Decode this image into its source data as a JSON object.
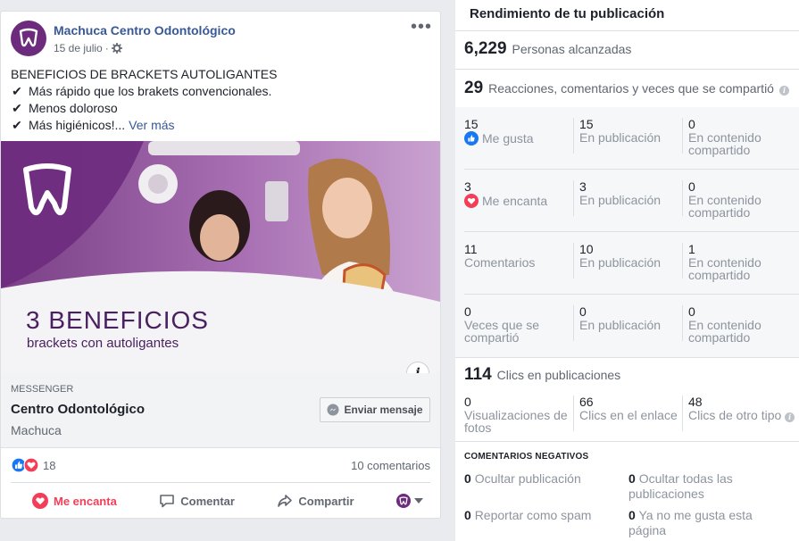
{
  "post": {
    "page_name": "Machuca Centro Odontológico",
    "date": "15 de julio",
    "date_sep": "·",
    "more_icon": "more-dots-icon",
    "text": {
      "heading": "BENEFICIOS DE BRACKETS AUTOLIGANTES",
      "bullets": [
        "Más rápido que los brakets convencionales.",
        "Menos doloroso",
        "Más higiénicos!..."
      ],
      "see_more": "Ver más"
    },
    "image": {
      "title": "3 BENEFICIOS",
      "subtitle": "brackets con autoligantes",
      "info_label": "i"
    },
    "cta": {
      "tag": "MESSENGER",
      "title": "Centro Odontológico",
      "subtitle": "Machuca",
      "button_label": "Enviar mensaje"
    },
    "reactions": {
      "count": "18",
      "comments": "10 comentarios"
    },
    "actions": {
      "love": "Me encanta",
      "comment": "Comentar",
      "share": "Compartir"
    }
  },
  "insights": {
    "title": "Rendimiento de tu publicación",
    "reach": {
      "value": "6,229",
      "label": "Personas alcanzadas"
    },
    "engagement": {
      "value": "29",
      "label": "Reacciones, comentarios y veces que se compartió"
    },
    "rows": [
      {
        "total": "15",
        "label": "Me gusta",
        "icon": "like-icon",
        "post": "15",
        "post_label": "En publicación",
        "shared": "0",
        "shared_label": "En contenido compartido"
      },
      {
        "total": "3",
        "label": "Me encanta",
        "icon": "love-icon",
        "post": "3",
        "post_label": "En publicación",
        "shared": "0",
        "shared_label": "En contenido compartido"
      },
      {
        "total": "11",
        "label": "Comentarios",
        "post": "10",
        "post_label": "En publicación",
        "shared": "1",
        "shared_label": "En contenido compartido"
      },
      {
        "total": "0",
        "label": "Veces que se compartió",
        "post": "0",
        "post_label": "En publicación",
        "shared": "0",
        "shared_label": "En contenido compartido"
      }
    ],
    "clicks": {
      "value": "114",
      "label": "Clics en publicaciones",
      "photos": {
        "value": "0",
        "label": "Visualizaciones de fotos"
      },
      "link": {
        "value": "66",
        "label": "Clics en el enlace"
      },
      "other": {
        "value": "48",
        "label": "Clics de otro tipo"
      }
    },
    "negative": {
      "title": "COMENTARIOS NEGATIVOS",
      "hide_post": {
        "value": "0",
        "label": "Ocultar publicación"
      },
      "hide_all": {
        "value": "0",
        "label": "Ocultar todas las publicaciones"
      },
      "spam": {
        "value": "0",
        "label": "Reportar como spam"
      },
      "unlike": {
        "value": "0",
        "label": "Ya no me gusta esta página"
      }
    }
  },
  "colors": {
    "link_blue": "#385898",
    "fb_blue": "#1877f2",
    "love_red": "#f33e58",
    "brand_purple": "#6d2b7d"
  }
}
